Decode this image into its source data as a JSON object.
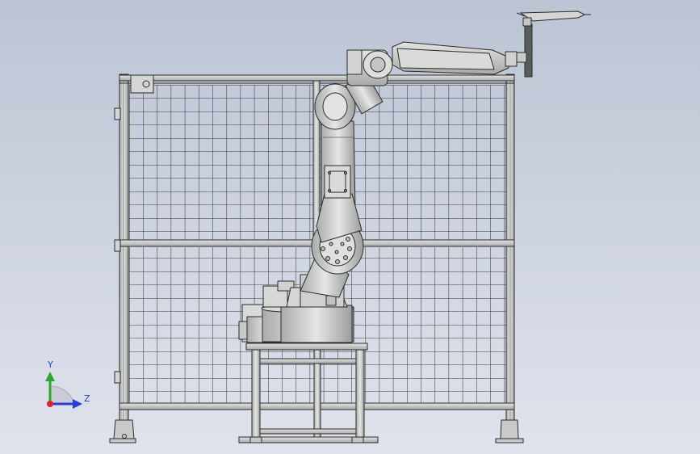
{
  "viewport": {
    "background_top": "#bcc4d4",
    "background_bottom": "#dfe3ec",
    "model_stroke": "#2b2b2b",
    "model_fill": "#cfd1cf",
    "mesh_fill": "#d9dbd9"
  },
  "triad": {
    "x_axis_color": "#e0202a",
    "y_axis_color": "#2aa82a",
    "z_axis_color": "#2a3fd8",
    "y_label": "Y",
    "z_label": "Z"
  },
  "model": {
    "objects": [
      "safety-fence",
      "robot-arm",
      "robot-pedestal",
      "welding-torch"
    ]
  }
}
